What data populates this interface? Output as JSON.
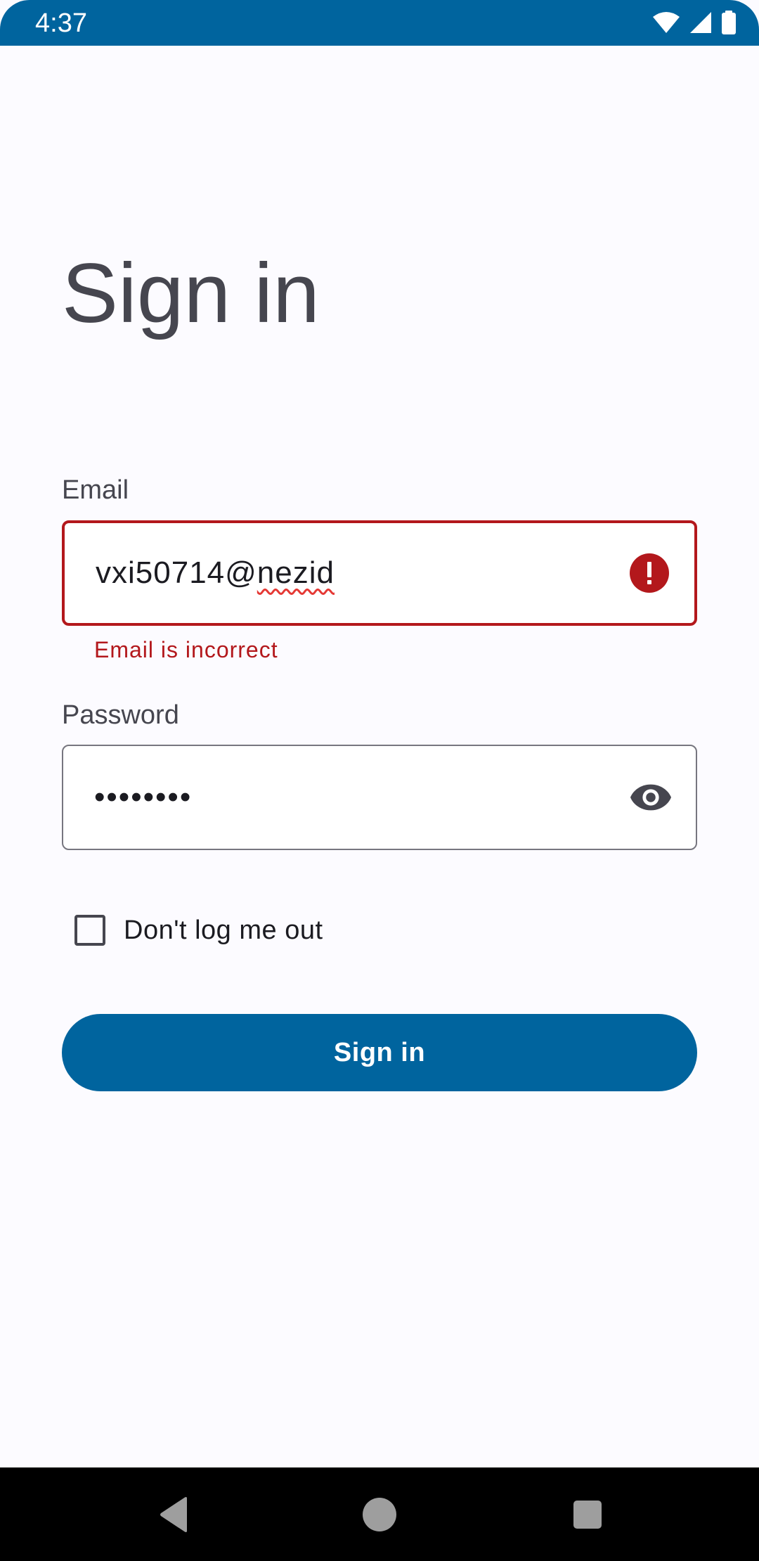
{
  "status_bar": {
    "time": "4:37",
    "icons": [
      "wifi-icon",
      "cellular-signal-icon",
      "battery-icon"
    ]
  },
  "page": {
    "title": "Sign in"
  },
  "email": {
    "label": "Email",
    "value_prefix": "vxi50714@",
    "value_misspelled": "nezid",
    "error": "Email is incorrect",
    "trailing_icon": "error-icon"
  },
  "password": {
    "label": "Password",
    "value": "••••••••",
    "trailing_icon": "visibility-eye-icon"
  },
  "remember": {
    "label": "Don't log me out",
    "checked": false
  },
  "actions": {
    "sign_in": "Sign in"
  },
  "nav_bar": {
    "icons": [
      "back-icon",
      "home-icon",
      "recents-icon"
    ]
  },
  "colors": {
    "primary": "#00649e",
    "error": "#b3181c",
    "background": "#fcfbff",
    "text": "#1b1b21",
    "text_muted": "#46464f"
  }
}
